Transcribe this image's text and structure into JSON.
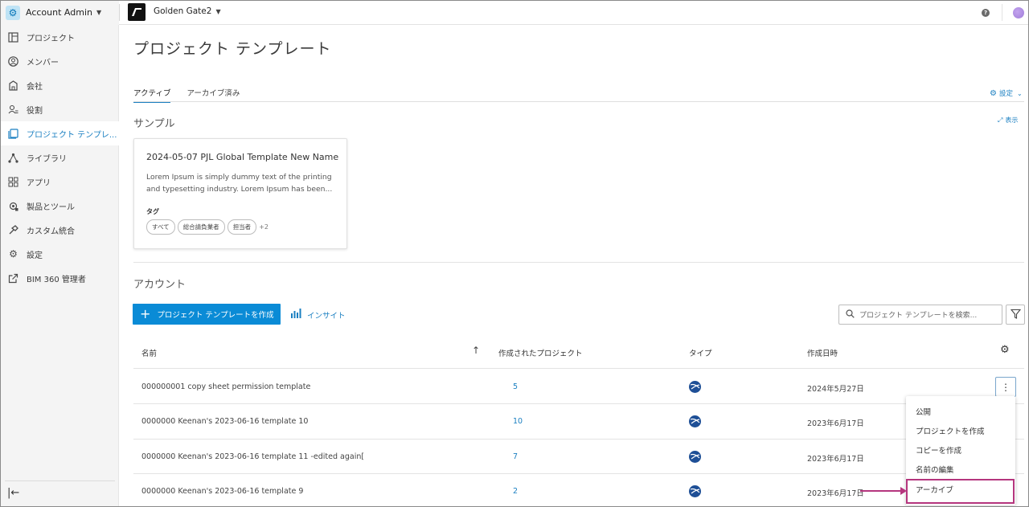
{
  "topbar": {
    "account_name": "Account Admin",
    "project_name": "Golden Gate2",
    "help_icon": "?"
  },
  "sidebar": {
    "items": [
      {
        "label": "プロジェクト",
        "icon": "project-icon"
      },
      {
        "label": "メンバー",
        "icon": "member-icon"
      },
      {
        "label": "会社",
        "icon": "company-icon"
      },
      {
        "label": "役割",
        "icon": "role-icon"
      },
      {
        "label": "プロジェクト テンプレ...",
        "icon": "template-icon",
        "active": true
      },
      {
        "label": "ライブラリ",
        "icon": "library-icon"
      },
      {
        "label": "アプリ",
        "icon": "apps-icon"
      },
      {
        "label": "製品とツール",
        "icon": "products-icon"
      },
      {
        "label": "カスタム統合",
        "icon": "integration-icon"
      },
      {
        "label": "設定",
        "icon": "settings-icon"
      },
      {
        "label": "BIM 360 管理者",
        "icon": "external-link-icon"
      }
    ]
  },
  "main": {
    "title": "プロジェクト テンプレート",
    "tabs": [
      {
        "label": "アクティブ",
        "active": true
      },
      {
        "label": "アーカイブ済み"
      }
    ],
    "settings_label": "設定",
    "sample_section": "サンプル",
    "expand_label": "表示",
    "card": {
      "title": "2024-05-07 PJL Global Template New Name",
      "description": "Lorem Ipsum is simply dummy text of the printing and typesetting industry. Lorem Ipsum has been...",
      "tag_label": "タグ",
      "tags": [
        "すべて",
        "総合請負業者",
        "担当者"
      ],
      "more_tags": "+2"
    },
    "account_section": "アカウント",
    "create_button": "プロジェクト テンプレートを作成",
    "insight_link": "インサイト",
    "search_placeholder": "プロジェクト テンプレートを検索..."
  },
  "table": {
    "headers": {
      "name": "名前",
      "created_projects": "作成されたプロジェクト",
      "type": "タイプ",
      "created_at": "作成日時"
    },
    "rows": [
      {
        "name": "000000001 copy sheet permission template",
        "count": "5",
        "date": "2024年5月27日"
      },
      {
        "name": "0000000 Keenan's 2023-06-16 template 10",
        "count": "10",
        "date": "2023年6月17日"
      },
      {
        "name": "0000000 Keenan's 2023-06-16 template 11 -edited again[",
        "count": "7",
        "date": "2023年6月17日"
      },
      {
        "name": "0000000 Keenan's 2023-06-16 template 9",
        "count": "2",
        "date": "2023年6月17日"
      }
    ]
  },
  "context_menu": {
    "items": [
      "公開",
      "プロジェクトを作成",
      "コピーを作成",
      "名前の編集",
      "アーカイブ"
    ],
    "highlighted": "アーカイブ"
  },
  "colors": {
    "accent": "#0a8bd6",
    "link": "#1a7fc1",
    "highlight": "#b5367e"
  }
}
